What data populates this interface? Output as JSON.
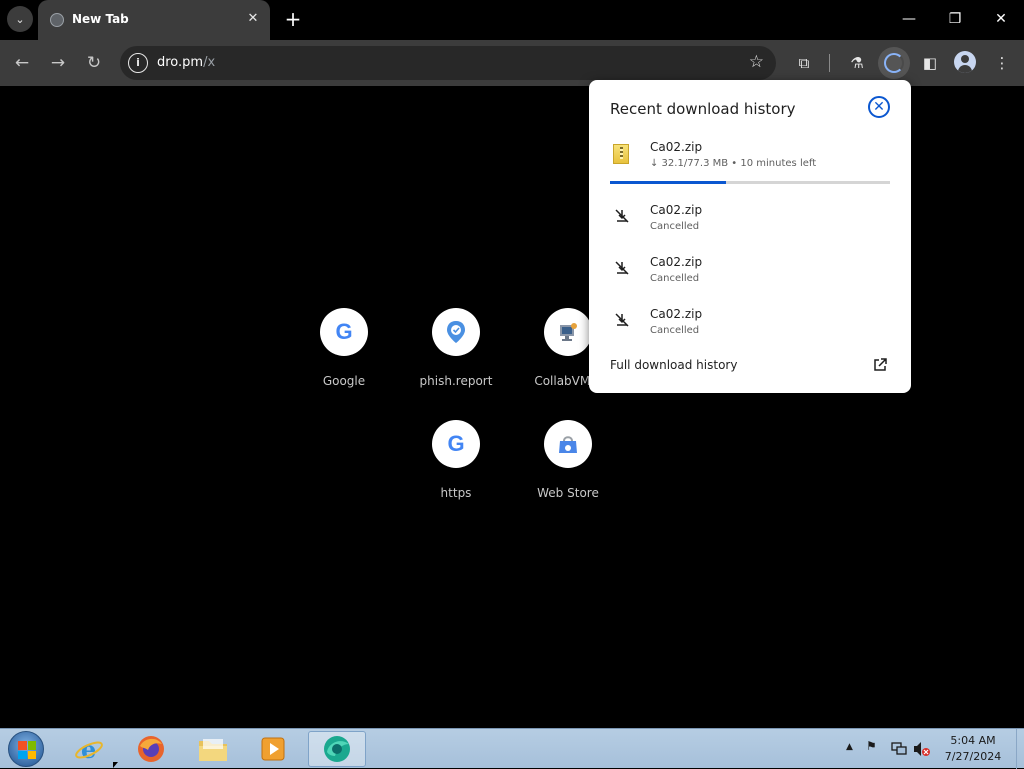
{
  "browser": {
    "tab": {
      "title": "New Tab",
      "close_glyph": "✕"
    },
    "tab_search_glyph": "⌄",
    "new_tab_glyph": "+",
    "window_controls": {
      "minimize": "—",
      "restore": "❐",
      "close": "✕"
    },
    "toolbar": {
      "back_glyph": "←",
      "forward_glyph": "→",
      "reload_glyph": "↻",
      "site_info_glyph": "i",
      "url_host": "dro.pm",
      "url_path": "/x",
      "bookmark_glyph": "☆",
      "extensions_glyph": "⧉",
      "labs_glyph": "⚗",
      "side_panel_glyph": "◧",
      "menu_glyph": "⋮"
    },
    "download_progress": 0.415
  },
  "shortcuts": [
    {
      "label": "Google",
      "icon": "google-logo"
    },
    {
      "label": "phish.report",
      "icon": "phish-report-icon"
    },
    {
      "label": "CollabVM S",
      "icon": "collabvm-icon"
    },
    {
      "label": "https",
      "icon": "google-logo"
    },
    {
      "label": "Web Store",
      "icon": "web-store-icon"
    }
  ],
  "download_panel": {
    "title": "Recent download history",
    "close_glyph": "✕",
    "items": [
      {
        "name": "Ca02.zip",
        "status": "↓ 32.1/77.3 MB • 10 minutes left",
        "state": "in-progress",
        "progress": 0.415
      },
      {
        "name": "Ca02.zip",
        "status": "Cancelled",
        "state": "cancelled"
      },
      {
        "name": "Ca02.zip",
        "status": "Cancelled",
        "state": "cancelled"
      },
      {
        "name": "Ca02.zip",
        "status": "Cancelled",
        "state": "cancelled"
      }
    ],
    "full_history_label": "Full download history",
    "accent_color": "#0b57d0"
  },
  "taskbar": {
    "apps": [
      {
        "name": "internet-explorer",
        "icon": "ie-icon"
      },
      {
        "name": "firefox",
        "icon": "firefox-icon"
      },
      {
        "name": "file-explorer",
        "icon": "folder-icon"
      },
      {
        "name": "media-player",
        "icon": "media-player-icon"
      },
      {
        "name": "browser",
        "icon": "browser-icon",
        "active": true
      }
    ],
    "tray": {
      "arrow_glyph": "▲",
      "flag_glyph": "⚑"
    },
    "clock": {
      "time": "5:04 AM",
      "date": "7/27/2024"
    }
  }
}
